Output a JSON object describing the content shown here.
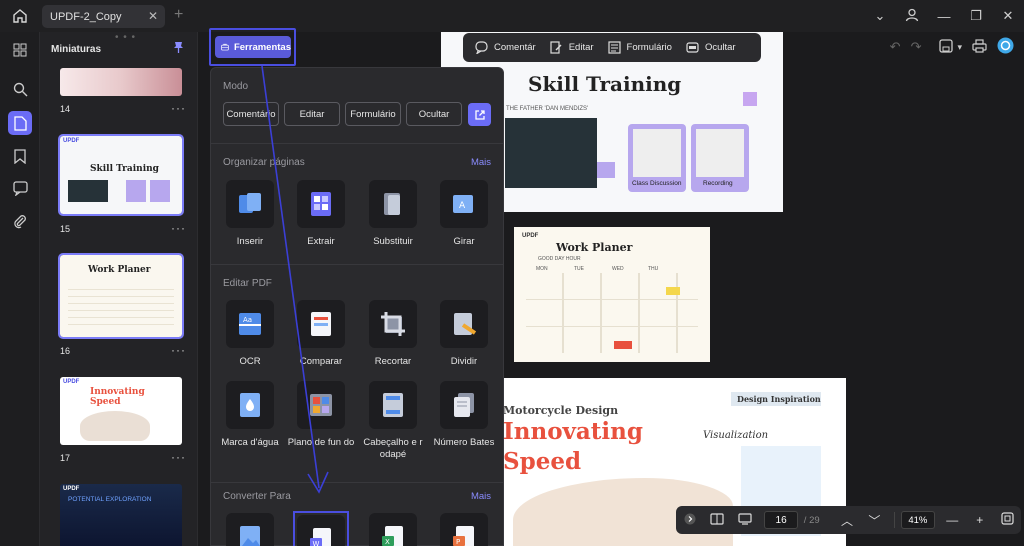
{
  "tab": {
    "title": "UPDF-2_Copy"
  },
  "thumbnails": {
    "header": "Miniaturas",
    "pages": [
      {
        "num": "14"
      },
      {
        "num": "15"
      },
      {
        "num": "16"
      },
      {
        "num": "17"
      }
    ],
    "thumb15": {
      "title": "Skill Training",
      "brand": "UPDF"
    },
    "thumb16": {
      "title": "Work Planer"
    },
    "thumb17": {
      "title1": "Innovating",
      "title2": "Speed",
      "brand": "UPDF"
    },
    "thumb18": {
      "title": "POTENTIAL EXPLORATION",
      "brand": "UPDF"
    }
  },
  "tools_button": {
    "label": "Ferramentas"
  },
  "panel": {
    "mode_title": "Modo",
    "modes": [
      "Comentário",
      "Editar",
      "Formulário",
      "Ocultar"
    ],
    "organize_title": "Organizar páginas",
    "organize_more": "Mais",
    "organize_tools": [
      "Inserir",
      "Extrair",
      "Substituir",
      "Girar"
    ],
    "edit_title": "Editar PDF",
    "edit_tools": [
      "OCR",
      "Comparar",
      "Recortar",
      "Dividir"
    ],
    "edit_tools2": [
      "Marca d'água",
      "Plano de fun do",
      "Cabeçalho e r odapé",
      "Número Bates"
    ],
    "convert_title": "Converter Para",
    "convert_more": "Mais"
  },
  "doc_toolbar": {
    "items": [
      "Comentár",
      "Editar",
      "Formulário",
      "Ocultar"
    ]
  },
  "document": {
    "page15": {
      "title": "Skill Training",
      "subtitle": "THE FATHER 'DAN MENDIZS'",
      "c1": "Class Discussion",
      "c2": "Recording"
    },
    "page16": {
      "brand": "UPDF",
      "title": "Work Planer",
      "subtitle": "GOOD DAY HOUR",
      "days": [
        "MON",
        "TUE",
        "WED",
        "THU"
      ]
    },
    "page17": {
      "kicker": "Motorcycle Design",
      "title1": "Innovating",
      "title2": "Speed",
      "box_title": "Design Inspiration",
      "script": "Visualization"
    }
  },
  "bottom_nav": {
    "page_current": "16",
    "page_total": "/ 29",
    "zoom": "41%"
  },
  "colors": {
    "accent": "#6b6cf6",
    "bg": "#1b1b1d",
    "panel": "#2a2a2d"
  }
}
